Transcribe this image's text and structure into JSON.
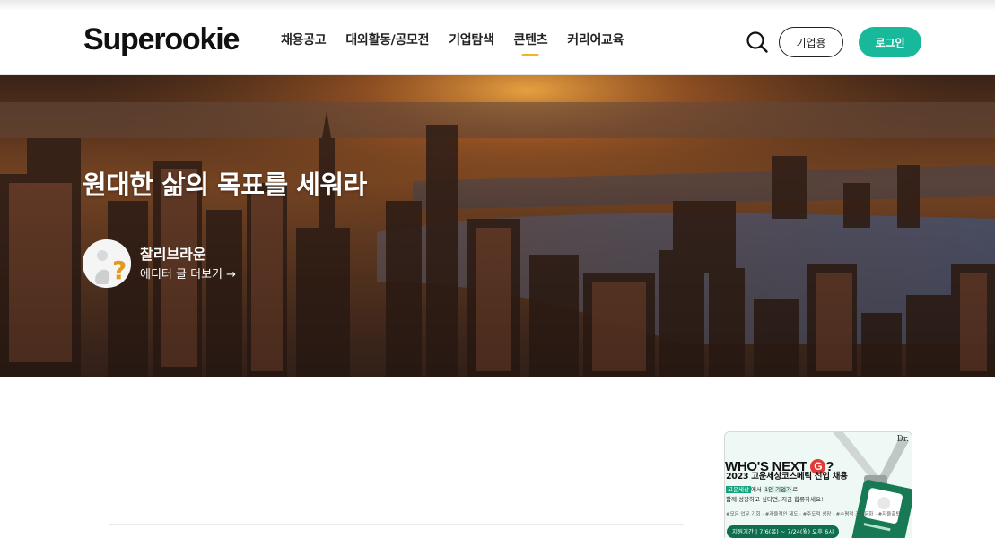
{
  "header": {
    "logo": "Superookie",
    "nav": [
      {
        "label": "채용공고",
        "active": false
      },
      {
        "label": "대외활동/공모전",
        "active": false
      },
      {
        "label": "기업탐색",
        "active": false
      },
      {
        "label": "콘텐츠",
        "active": true
      },
      {
        "label": "커리어교육",
        "active": false
      }
    ],
    "search_icon": "search-icon",
    "business_button": "기업용",
    "login_button": "로그인",
    "colors": {
      "accent": "#17b99a",
      "nav_underline": "#f3b229"
    }
  },
  "hero": {
    "title": "원대한 삶의 목표를 세워라",
    "author": {
      "name": "찰리브라운",
      "link": "에디터 글 더보기 →",
      "avatar": "question-mark-figure-avatar"
    }
  },
  "ad": {
    "brand": "Dr.",
    "headline": "WHO'S NEXT",
    "headline_mark": "G",
    "headline_end": "?",
    "subheadline": "2023 고운세상코스메틱 신입 채용",
    "line1_chip": "고운세상",
    "line1_mid": "에서",
    "line1_mark": "1인 기업가",
    "line1_end": "로",
    "line2": "함께 성장하고 싶다면, 지금 합류하세요!",
    "line3": "#모든 업무 기회 · #자율적인 제도 · #주도적 성장 · #수평적 조직문화 · #자율출퇴근",
    "period": "지원기간 | 7/6(목) ~ 7/24(월) 오후 6시"
  }
}
